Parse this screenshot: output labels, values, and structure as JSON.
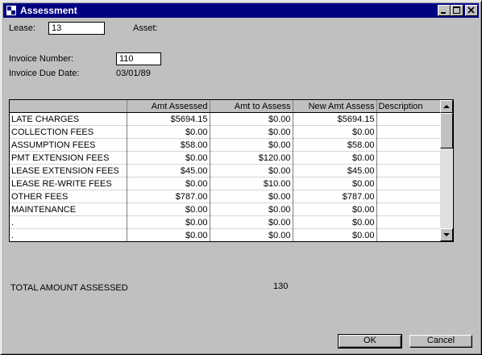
{
  "window": {
    "title": "Assessment"
  },
  "lease": {
    "label": "Lease:",
    "value": "13"
  },
  "asset": {
    "label": "Asset:"
  },
  "invoice": {
    "number_label": "Invoice Number:",
    "number_value": "110",
    "due_label": "Invoice Due Date:",
    "due_value": "03/01/89"
  },
  "grid": {
    "columns": [
      "",
      "Amt Assessed",
      "Amt to Assess",
      "New Amt Assess",
      "Description"
    ],
    "rows": [
      [
        "LATE CHARGES",
        "$5694.15",
        "$0.00",
        "$5694.15",
        ""
      ],
      [
        "COLLECTION FEES",
        "$0.00",
        "$0.00",
        "$0.00",
        ""
      ],
      [
        "ASSUMPTION FEES",
        "$58.00",
        "$0.00",
        "$58.00",
        ""
      ],
      [
        "PMT EXTENSION FEES",
        "$0.00",
        "$120.00",
        "$0.00",
        ""
      ],
      [
        "LEASE EXTENSION FEES",
        "$45.00",
        "$0.00",
        "$45.00",
        ""
      ],
      [
        "LEASE RE-WRITE FEES",
        "$0.00",
        "$10.00",
        "$0.00",
        ""
      ],
      [
        "OTHER FEES",
        "$787.00",
        "$0.00",
        "$787.00",
        ""
      ],
      [
        "MAINTENANCE",
        "$0.00",
        "$0.00",
        "$0.00",
        ""
      ],
      [
        ".",
        "$0.00",
        "$0.00",
        "$0.00",
        ""
      ],
      [
        ".",
        "$0.00",
        "$0.00",
        "$0.00",
        ""
      ]
    ]
  },
  "total": {
    "label": "TOTAL AMOUNT ASSESSED",
    "value": "130"
  },
  "buttons": {
    "ok": "OK",
    "cancel": "Cancel"
  }
}
